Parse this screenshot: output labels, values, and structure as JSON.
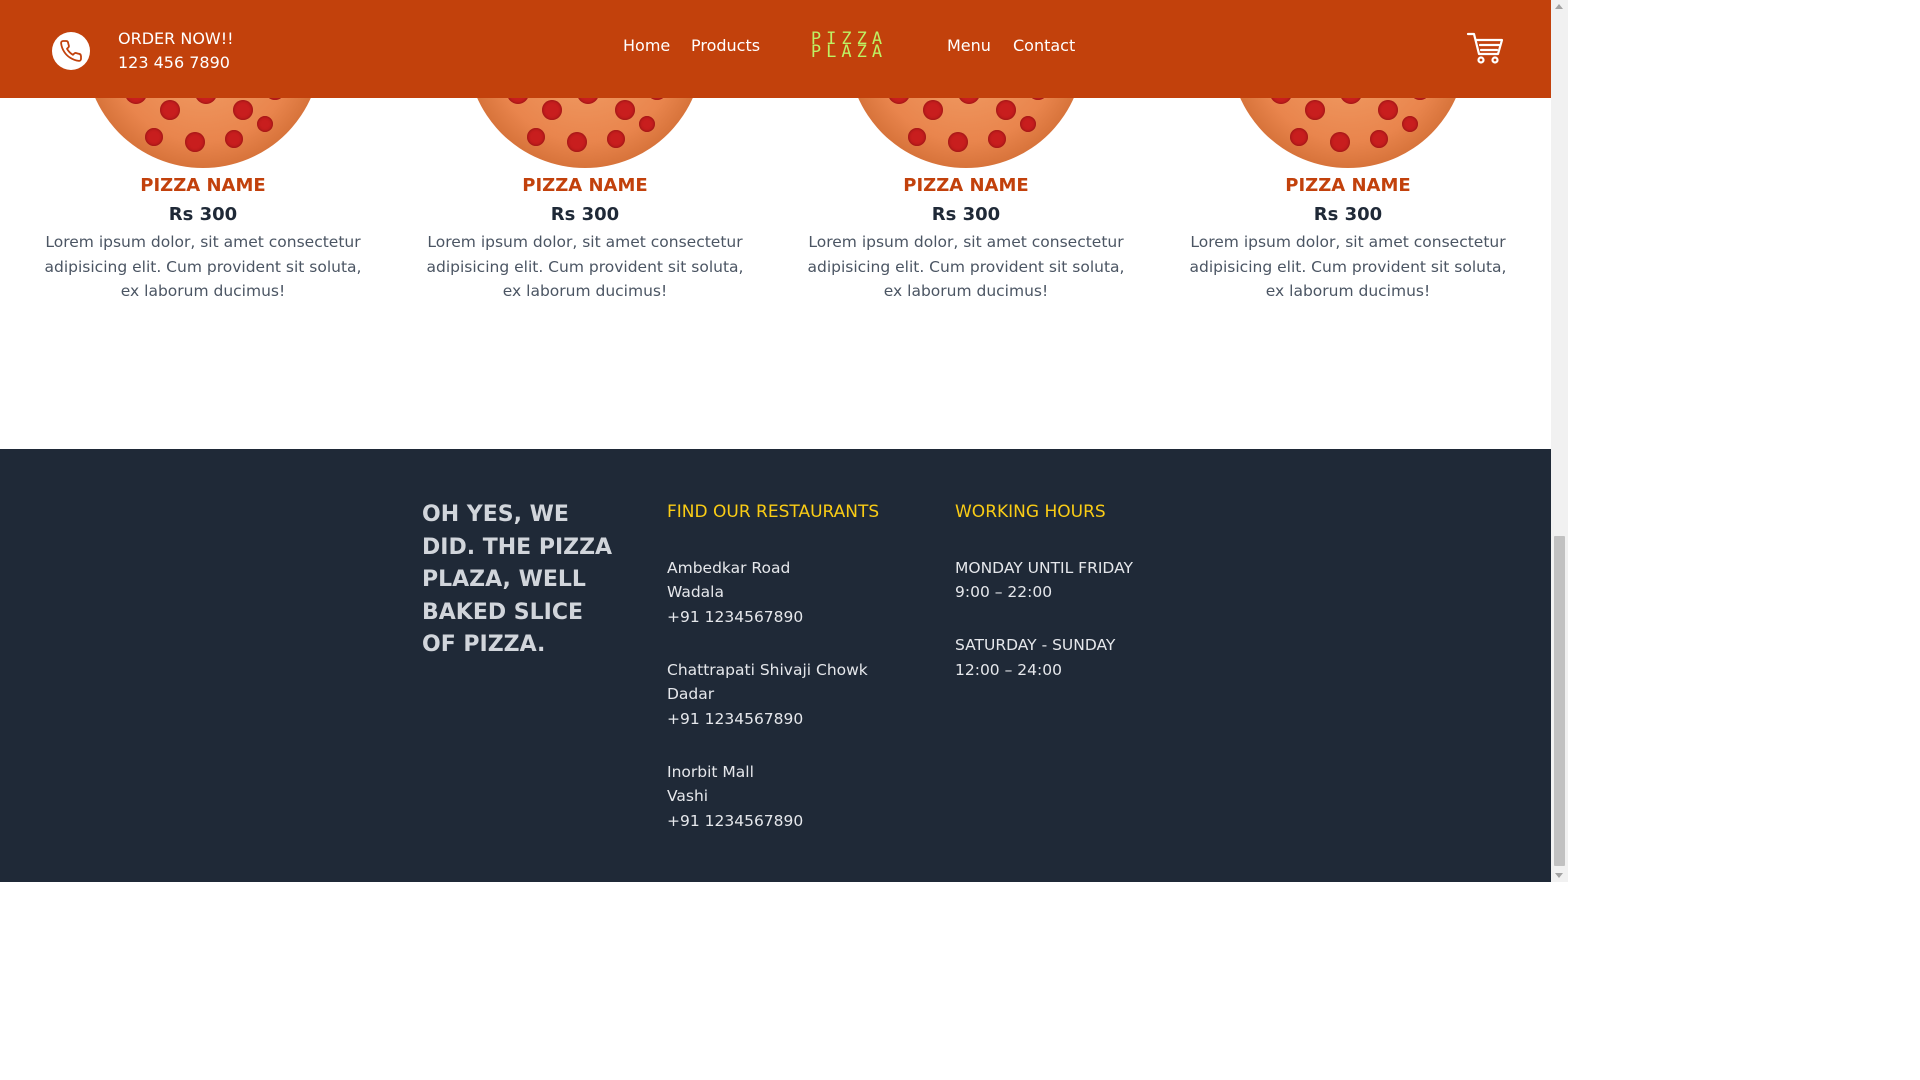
{
  "header": {
    "order_label": "ORDER NOW!!",
    "phone": "123 456 7890",
    "nav_left": [
      "Home",
      "Products"
    ],
    "logo_line1": "PIZZA",
    "logo_line2": "PLAZA",
    "nav_right": [
      "Menu",
      "Contact"
    ],
    "brand_color": "#c2410c",
    "logo_color": "#bef264",
    "phone_icon": "phone-icon",
    "cart_icon": "cart-icon"
  },
  "products": [
    {
      "name": "PIZZA NAME",
      "price": "Rs 300",
      "description": "Lorem ipsum dolor, sit amet consectetur adipisicing elit. Cum provident sit soluta, ex laborum ducimus!"
    },
    {
      "name": "PIZZA NAME",
      "price": "Rs 300",
      "description": "Lorem ipsum dolor, sit amet consectetur adipisicing elit. Cum provident sit soluta, ex laborum ducimus!"
    },
    {
      "name": "PIZZA NAME",
      "price": "Rs 300",
      "description": "Lorem ipsum dolor, sit amet consectetur adipisicing elit. Cum provident sit soluta, ex laborum ducimus!"
    },
    {
      "name": "PIZZA NAME",
      "price": "Rs 300",
      "description": "Lorem ipsum dolor, sit amet consectetur adipisicing elit. Cum provident sit soluta, ex laborum ducimus!"
    }
  ],
  "footer": {
    "tagline": "OH YES, WE DID. THE PIZZA PLAZA, WELL BAKED SLICE OF PIZZA.",
    "restaurants_heading": "FIND OUR RESTAURANTS",
    "restaurants": [
      {
        "street": "Ambedkar Road",
        "area": "Wadala",
        "phone": "+91 1234567890"
      },
      {
        "street": "Chattrapati Shivaji Chowk",
        "area": "Dadar",
        "phone": "+91 1234567890"
      },
      {
        "street": "Inorbit Mall",
        "area": "Vashi",
        "phone": "+91 1234567890"
      }
    ],
    "hours_heading": "WORKING HOURS",
    "hours": [
      {
        "days": "MONDAY UNTIL FRIDAY",
        "time": "9:00 – 22:00"
      },
      {
        "days": "SATURDAY - SUNDAY",
        "time": "12:00 – 24:00"
      }
    ],
    "background_color": "#1f2937",
    "heading_color": "#facc15"
  }
}
